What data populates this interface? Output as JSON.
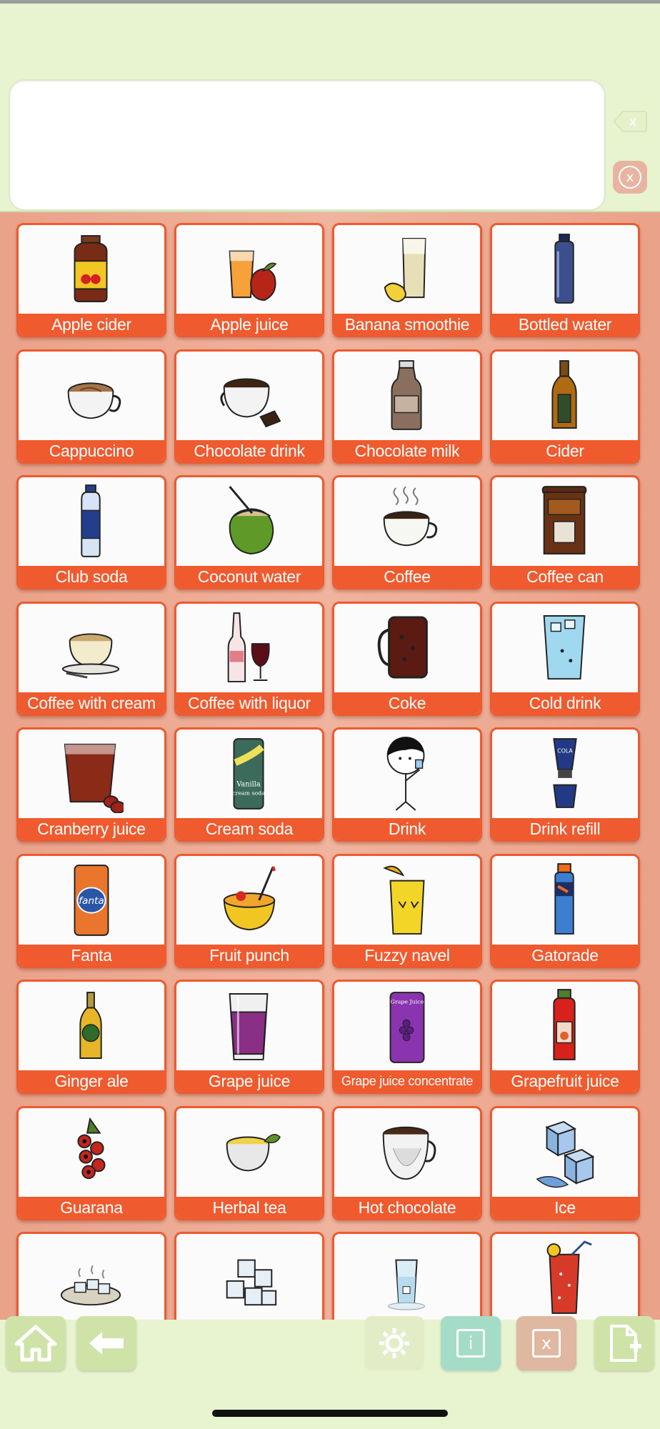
{
  "header": {
    "message_text": "",
    "backspace_symbol": "x",
    "clear_symbol": "x"
  },
  "tiles": [
    {
      "label": "Apple cider",
      "icon": "apple-cider-jug-icon"
    },
    {
      "label": "Apple juice",
      "icon": "apple-juice-icon"
    },
    {
      "label": "Banana smoothie",
      "icon": "banana-smoothie-icon"
    },
    {
      "label": "Bottled water",
      "icon": "bottled-water-icon"
    },
    {
      "label": "Cappuccino",
      "icon": "cappuccino-icon"
    },
    {
      "label": "Chocolate drink",
      "icon": "chocolate-drink-icon"
    },
    {
      "label": "Chocolate milk",
      "icon": "chocolate-milk-icon"
    },
    {
      "label": "Cider",
      "icon": "cider-bottle-icon"
    },
    {
      "label": "Club soda",
      "icon": "club-soda-icon"
    },
    {
      "label": "Coconut water",
      "icon": "coconut-water-icon"
    },
    {
      "label": "Coffee",
      "icon": "coffee-cup-icon"
    },
    {
      "label": "Coffee can",
      "icon": "coffee-can-icon"
    },
    {
      "label": "Coffee with cream",
      "icon": "coffee-with-cream-icon"
    },
    {
      "label": "Coffee with liquor",
      "icon": "coffee-with-liquor-icon"
    },
    {
      "label": "Coke",
      "icon": "coke-mug-icon"
    },
    {
      "label": "Cold drink",
      "icon": "cold-drink-icon"
    },
    {
      "label": "Cranberry juice",
      "icon": "cranberry-juice-icon"
    },
    {
      "label": "Cream soda",
      "icon": "cream-soda-can-icon"
    },
    {
      "label": "Drink",
      "icon": "person-drinking-icon"
    },
    {
      "label": "Drink refill",
      "icon": "drink-refill-icon"
    },
    {
      "label": "Fanta",
      "icon": "fanta-can-icon"
    },
    {
      "label": "Fruit punch",
      "icon": "fruit-punch-icon"
    },
    {
      "label": "Fuzzy navel",
      "icon": "fuzzy-navel-icon"
    },
    {
      "label": "Gatorade",
      "icon": "gatorade-bottle-icon"
    },
    {
      "label": "Ginger ale",
      "icon": "ginger-ale-bottle-icon"
    },
    {
      "label": "Grape juice",
      "icon": "grape-juice-icon"
    },
    {
      "label": "Grape juice concentrate",
      "icon": "grape-juice-concentrate-icon"
    },
    {
      "label": "Grapefruit juice",
      "icon": "grapefruit-juice-icon"
    },
    {
      "label": "Guarana",
      "icon": "guarana-icon"
    },
    {
      "label": "Herbal tea",
      "icon": "herbal-tea-icon"
    },
    {
      "label": "Hot chocolate",
      "icon": "hot-chocolate-icon"
    },
    {
      "label": "Ice",
      "icon": "ice-cubes-icon"
    },
    {
      "label": "",
      "icon": "ice-plate-icon"
    },
    {
      "label": "",
      "icon": "ice-cubes-stack-icon"
    },
    {
      "label": "",
      "icon": "glass-of-water-icon"
    },
    {
      "label": "",
      "icon": "iced-drink-icon"
    }
  ],
  "toolbar": {
    "home": "home-icon",
    "back": "back-arrow-icon",
    "settings": "gear-icon",
    "info": "i",
    "close": "x",
    "new_page": "add-page-icon"
  },
  "colors": {
    "header_bg": "#e8f3cf",
    "tile_border": "#ec5b30",
    "label_bg": "#ef5a2e",
    "grid_bg": "#eaa28a"
  }
}
